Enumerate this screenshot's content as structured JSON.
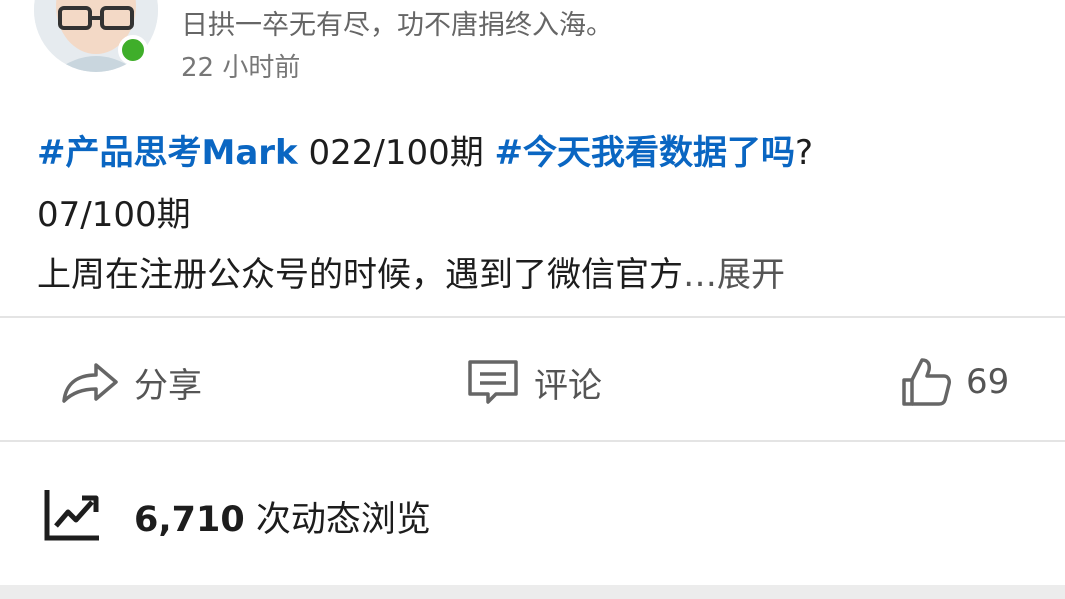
{
  "author": {
    "headline": "日拱一卒无有尽，功不唐捐终入海。",
    "time": "22 小时前"
  },
  "post": {
    "tag1": "#产品思考Mark",
    "text1": " 022/100期 ",
    "tag2": "#今天我看数据了吗",
    "text1_end": "?",
    "line2": "07/100期",
    "line3": "上周在注册公众号的时候，遇到了微信官方",
    "expand": "…展开"
  },
  "actions": {
    "share": "分享",
    "comment": "评论",
    "like_count": "69"
  },
  "views": {
    "count": "6,710",
    "label": " 次动态浏览"
  },
  "colors": {
    "hashtag": "#0a66c2",
    "online": "#3fae2a"
  },
  "icons": [
    "avatar",
    "online-status-icon",
    "share-icon",
    "comment-icon",
    "like-icon",
    "analytics-trend-icon"
  ]
}
